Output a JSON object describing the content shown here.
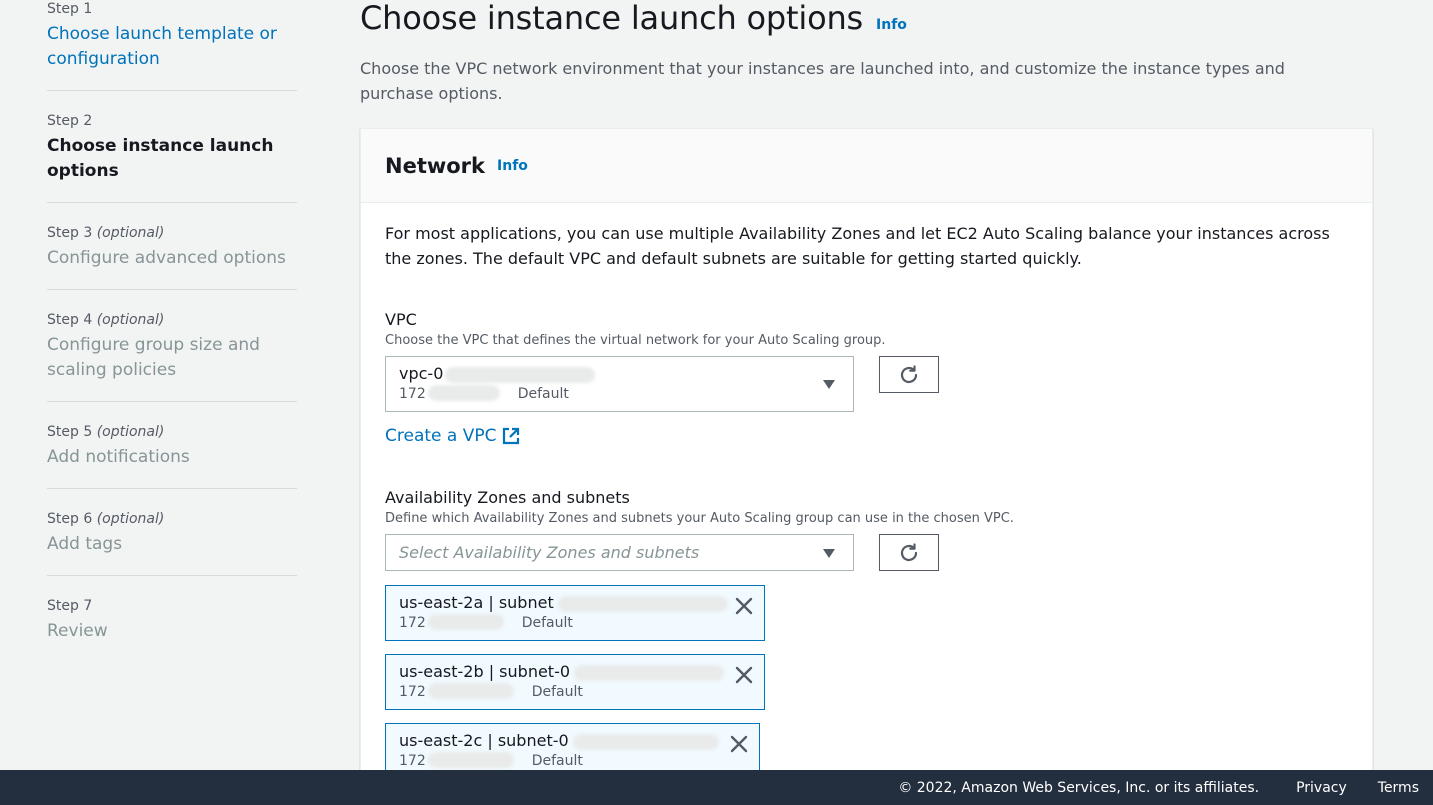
{
  "steps": [
    {
      "num": "Step 1",
      "optional": "",
      "title": "Choose launch template or configuration",
      "state": "link"
    },
    {
      "num": "Step 2",
      "optional": "",
      "title": "Choose instance launch options",
      "state": "current"
    },
    {
      "num": "Step 3",
      "optional": "(optional)",
      "title": "Configure advanced options",
      "state": "disabled"
    },
    {
      "num": "Step 4",
      "optional": "(optional)",
      "title": "Configure group size and scaling policies",
      "state": "disabled"
    },
    {
      "num": "Step 5",
      "optional": "(optional)",
      "title": "Add notifications",
      "state": "disabled"
    },
    {
      "num": "Step 6",
      "optional": "(optional)",
      "title": "Add tags",
      "state": "disabled"
    },
    {
      "num": "Step 7",
      "optional": "",
      "title": "Review",
      "state": "disabled"
    }
  ],
  "header": {
    "title": "Choose instance launch options",
    "info": "Info",
    "description": "Choose the VPC network environment that your instances are launched into, and customize the instance types and purchase options."
  },
  "network": {
    "title": "Network",
    "info": "Info",
    "description": "For most applications, you can use multiple Availability Zones and let EC2 Auto Scaling balance your instances across the zones. The default VPC and default subnets are suitable for getting started quickly.",
    "vpc": {
      "label": "VPC",
      "description": "Choose the VPC that defines the virtual network for your Auto Scaling group.",
      "selected_id": "vpc-0",
      "selected_cidr": "172",
      "selected_tag": "Default",
      "create_link": "Create a VPC"
    },
    "zones": {
      "label": "Availability Zones and subnets",
      "description": "Define which Availability Zones and subnets your Auto Scaling group can use in the chosen VPC.",
      "placeholder": "Select Availability Zones and subnets",
      "tokens": [
        {
          "label": "us-east-2a | subnet",
          "cidr": "172",
          "tag": "Default"
        },
        {
          "label": "us-east-2b | subnet-0",
          "cidr": "172",
          "tag": "Default"
        },
        {
          "label": "us-east-2c | subnet-0",
          "cidr": "172",
          "tag": "Default"
        }
      ]
    }
  },
  "footer": {
    "copyright": "© 2022, Amazon Web Services, Inc. or its affiliates.",
    "privacy": "Privacy",
    "terms": "Terms"
  },
  "colors": {
    "link": "#0073bb",
    "footer_bg": "#232f3e",
    "token_bg": "#f1faff"
  }
}
